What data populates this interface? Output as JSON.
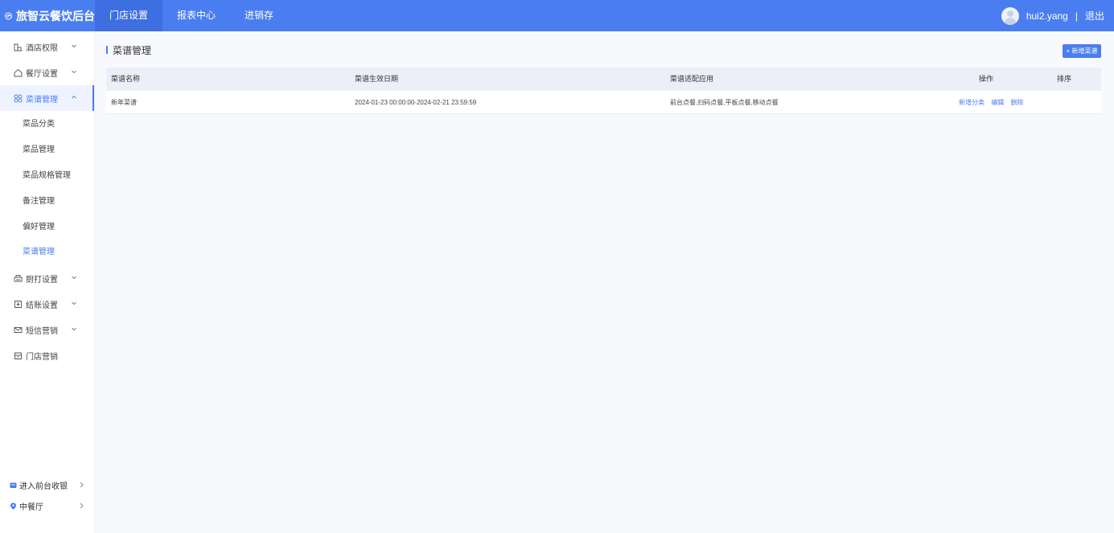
{
  "app": {
    "brand": "旅智云餐饮后台"
  },
  "topnav": [
    {
      "label": "门店设置",
      "active": true
    },
    {
      "label": "报表中心",
      "active": false
    },
    {
      "label": "进销存",
      "active": false
    }
  ],
  "user": {
    "name": "hui2.yang",
    "separator": "|",
    "logout": "退出"
  },
  "sidebar": {
    "items": [
      {
        "label": "酒店权限",
        "icon": "hotel-icon"
      },
      {
        "label": "餐厅设置",
        "icon": "home-icon"
      },
      {
        "label": "菜谱管理",
        "icon": "grid-icon"
      },
      {
        "label": "厨打设置",
        "icon": "printer-icon"
      },
      {
        "label": "结账设置",
        "icon": "checkout-icon"
      },
      {
        "label": "短信营销",
        "icon": "mail-icon"
      },
      {
        "label": "门店营销",
        "icon": "store-icon"
      }
    ],
    "subitems": [
      "菜品分类",
      "菜品管理",
      "菜品规格管理",
      "备注管理",
      "偏好管理",
      "菜谱管理"
    ],
    "bottom": [
      {
        "label": "进入前台收银",
        "icon": "cashier-icon"
      },
      {
        "label": "中餐厅",
        "icon": "location-icon"
      }
    ]
  },
  "main": {
    "title": "菜谱管理",
    "add_button": "+ 新增菜谱",
    "table": {
      "headers": [
        "菜谱名称",
        "菜谱生效日期",
        "菜谱适配应用",
        "操作",
        "排序"
      ],
      "rows": [
        {
          "name": "新年菜谱",
          "date": "2024-01-23 00:00:00-2024-02-21 23:59:59",
          "apps": "前台点餐,扫码点餐,平板点餐,移动点餐",
          "actions": [
            "新增分类",
            "编辑",
            "删除"
          ],
          "sort": ""
        }
      ]
    }
  },
  "colors": {
    "primary": "#4a7ef0",
    "background": "#f8f9fd"
  }
}
